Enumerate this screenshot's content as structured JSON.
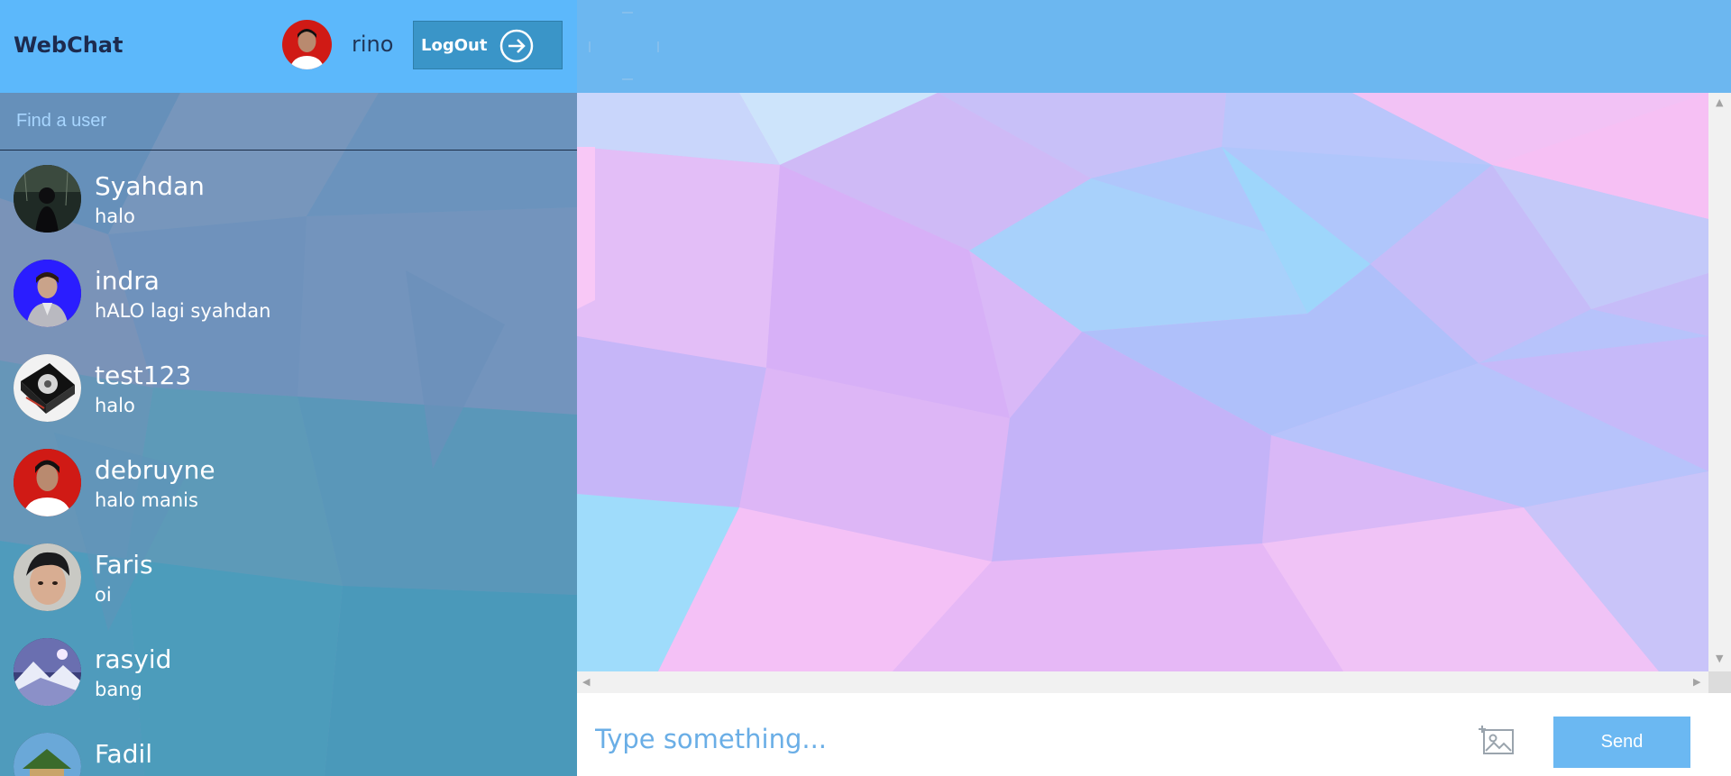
{
  "app": {
    "brand": "WebChat"
  },
  "header": {
    "current_user": "rino",
    "logout_label": "LogOut"
  },
  "search": {
    "placeholder": "Find a user"
  },
  "users": [
    {
      "name": "Syahdan",
      "last_message": "halo"
    },
    {
      "name": "indra",
      "last_message": "hALO lagi syahdan"
    },
    {
      "name": "test123",
      "last_message": "halo"
    },
    {
      "name": "debruyne",
      "last_message": "halo manis"
    },
    {
      "name": "Faris",
      "last_message": "oi"
    },
    {
      "name": "rasyid",
      "last_message": "bang"
    },
    {
      "name": "Fadil",
      "last_message": ""
    }
  ],
  "composer": {
    "placeholder": "Type something...",
    "send_label": "Send"
  },
  "colors": {
    "header_left": "#5cb8fb",
    "header_right": "#6cb7f0",
    "logout_button": "#3a95c8",
    "send_button": "#6bb8f2",
    "brand_text": "#1d2b4e"
  },
  "icons": {
    "logout": "arrow-right-circle-icon",
    "image": "image-icon",
    "scroll_up": "triangle-up-icon",
    "scroll_down": "triangle-down-icon",
    "scroll_left": "triangle-left-icon",
    "scroll_right": "triangle-right-icon"
  }
}
